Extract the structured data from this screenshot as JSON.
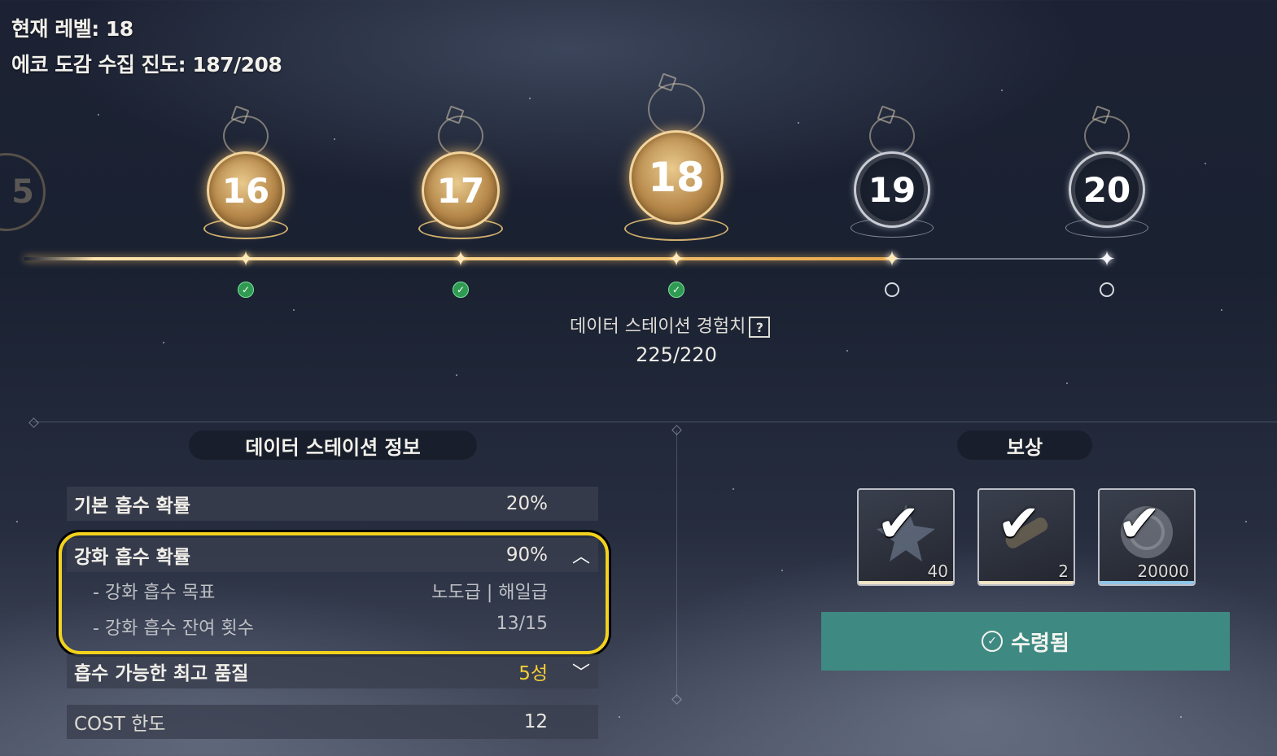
{
  "header": {
    "current_level_label": "현재 레벨: 18",
    "collection_progress_label": "에코 도감 수집 진도: 187/208"
  },
  "timeline": {
    "partial_left_level": "5",
    "levels": [
      {
        "level": "16",
        "status": "claimed"
      },
      {
        "level": "17",
        "status": "claimed"
      },
      {
        "level": "18",
        "status": "claimed"
      },
      {
        "level": "19",
        "status": "locked"
      },
      {
        "level": "20",
        "status": "locked"
      }
    ],
    "exp_label": "데이터 스테이션 경험치",
    "exp_help_icon": "question-icon",
    "exp_value": "225/220"
  },
  "info": {
    "title": "데이터 스테이션 정보",
    "rows": {
      "base_rate": {
        "label": "기본 흡수 확률",
        "value": "20%"
      },
      "enhance_rate": {
        "label": "강화 흡수 확률",
        "value": "90%",
        "chevron": "^"
      },
      "enhance_target": {
        "label": "- 강화 흡수 목표",
        "value": "노도급 | 해일급"
      },
      "enhance_remaining": {
        "label": "- 강화 흡수 잔여 횟수",
        "value": "13/15"
      },
      "max_quality": {
        "label": "흡수 가능한 최고 품질",
        "value": "5성",
        "chevron": "v"
      },
      "cost_limit": {
        "label": "COST 한도",
        "value": "12"
      }
    }
  },
  "rewards": {
    "title": "보상",
    "items": [
      {
        "icon": "star-crystal-icon",
        "count": "40",
        "bar_color": "#f2e6c8"
      },
      {
        "icon": "scroll-tube-icon",
        "count": "2",
        "bar_color": "#f2e6c8"
      },
      {
        "icon": "shell-coin-icon",
        "count": "20000",
        "bar_color": "#8fc6e8"
      }
    ],
    "claim_button": "수령됨"
  },
  "colors": {
    "highlight": "#f2d21d",
    "claimed_gold": "#f2d49c",
    "claim_button": "#3e8a82",
    "check_green": "#2f9a52"
  }
}
